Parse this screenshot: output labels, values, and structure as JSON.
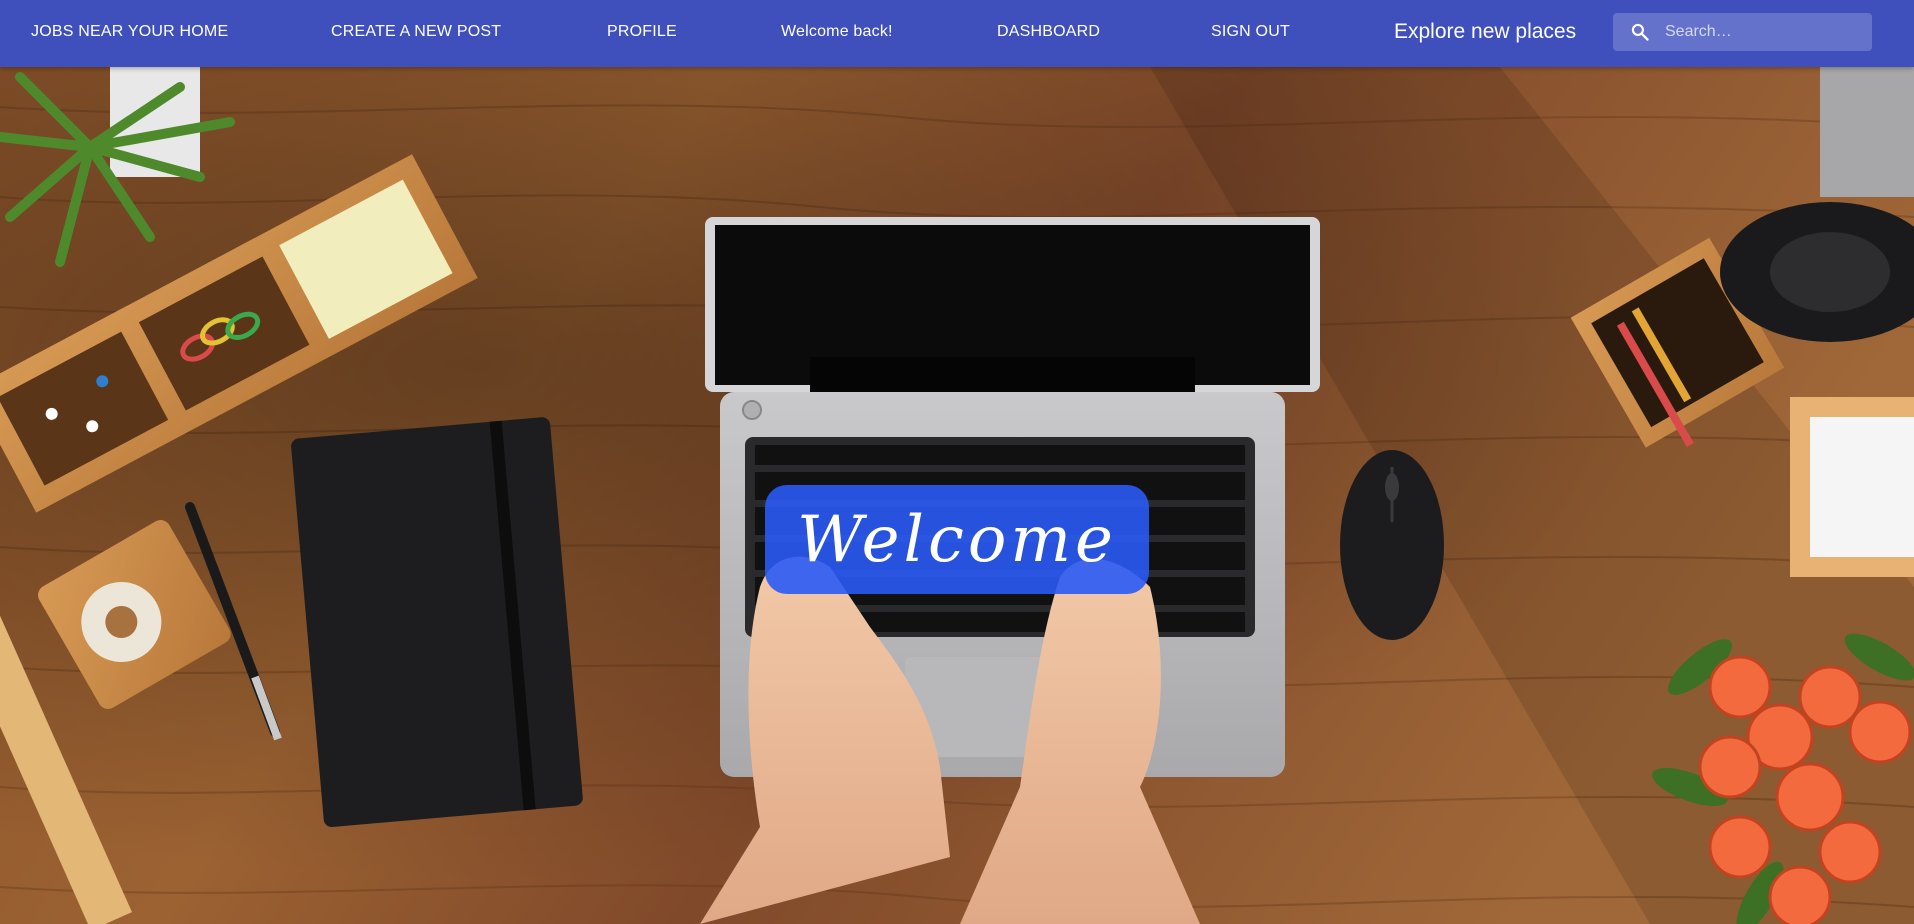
{
  "nav": {
    "items": [
      {
        "label": "JOBS NEAR YOUR HOME"
      },
      {
        "label": "CREATE A NEW POST"
      },
      {
        "label": "PROFILE"
      },
      {
        "label": "Welcome back!"
      },
      {
        "label": "DASHBOARD"
      },
      {
        "label": "SIGN OUT"
      }
    ],
    "brand_title": "Explore new places",
    "search": {
      "placeholder": "Search…",
      "icon": "search-icon"
    }
  },
  "hero": {
    "welcome_text": "Welcome",
    "image": "desk-with-laptop-and-hands"
  },
  "colors": {
    "nav_background": "#3f4fbc",
    "search_background": "#6572cb",
    "welcome_background": "#2a5af5"
  }
}
